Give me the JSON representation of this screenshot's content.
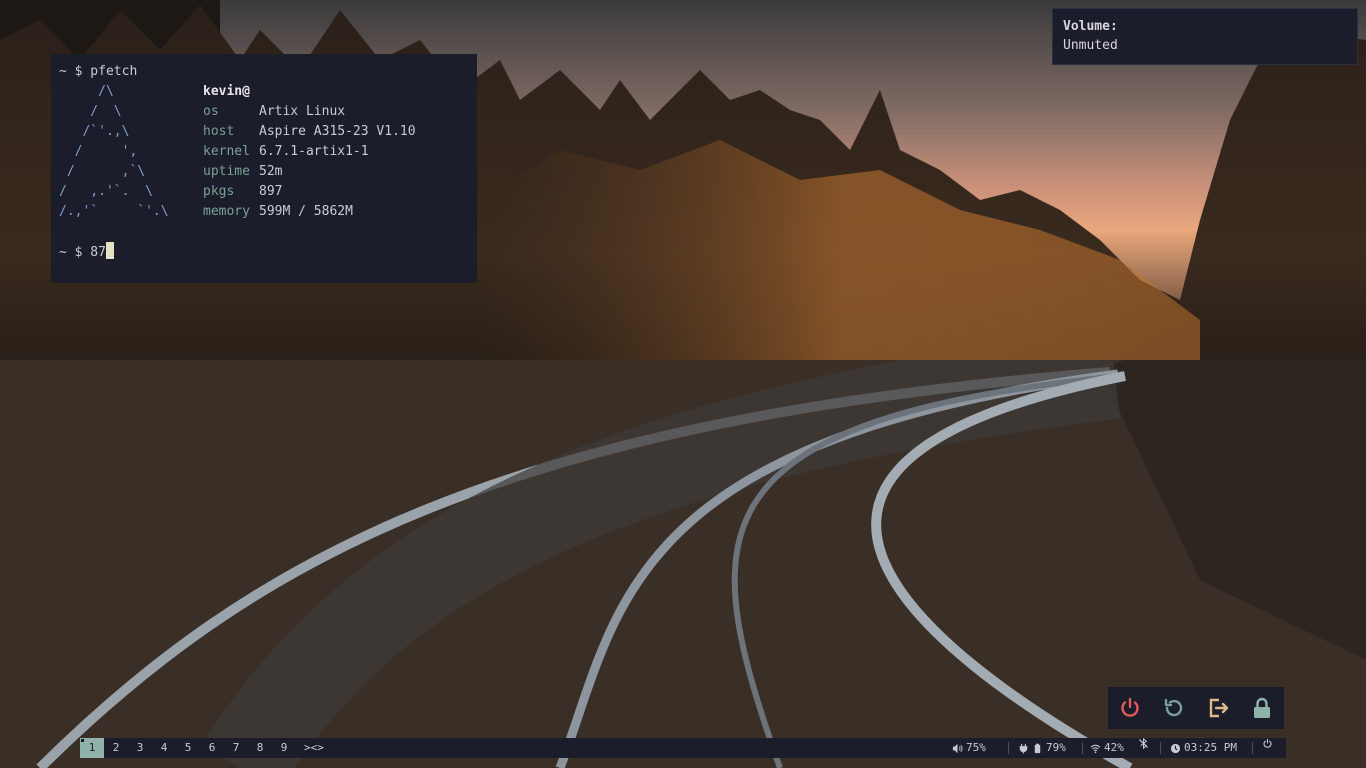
{
  "terminal": {
    "prompt1": "~ $ pfetch",
    "user": "kevin@",
    "ascii_art": "     /\\\n    /  \\\n   /`'.,\\\n  /     ',\n /      ,`\\\n/   ,.'`.  \\\n/.,'`     `'.\\",
    "info": [
      {
        "key": "os",
        "value": "Artix Linux"
      },
      {
        "key": "host",
        "value": "Aspire A315-23 V1.10"
      },
      {
        "key": "kernel",
        "value": "6.7.1-artix1-1"
      },
      {
        "key": "uptime",
        "value": "52m"
      },
      {
        "key": "pkgs",
        "value": "897"
      },
      {
        "key": "memory",
        "value": "599M / 5862M"
      }
    ],
    "prompt2": "~ $ 87"
  },
  "notification": {
    "title": "Volume:",
    "body": "Unmuted"
  },
  "power_menu": {
    "buttons": [
      {
        "name": "shutdown",
        "icon": "power-icon",
        "color": "#e05a5a"
      },
      {
        "name": "reboot",
        "icon": "reboot-icon",
        "color": "#7aa095"
      },
      {
        "name": "logout",
        "icon": "logout-icon",
        "color": "#d9b98a"
      },
      {
        "name": "lock",
        "icon": "lock-icon",
        "color": "#8fb3a9"
      }
    ]
  },
  "bar": {
    "workspaces": [
      "1",
      "2",
      "3",
      "4",
      "5",
      "6",
      "7",
      "8",
      "9"
    ],
    "active_workspace": "1",
    "layout": "><>",
    "volume": "75%",
    "battery": "79%",
    "wifi": "42%",
    "time": "03:25 PM",
    "accent": "#8fb3a9"
  }
}
